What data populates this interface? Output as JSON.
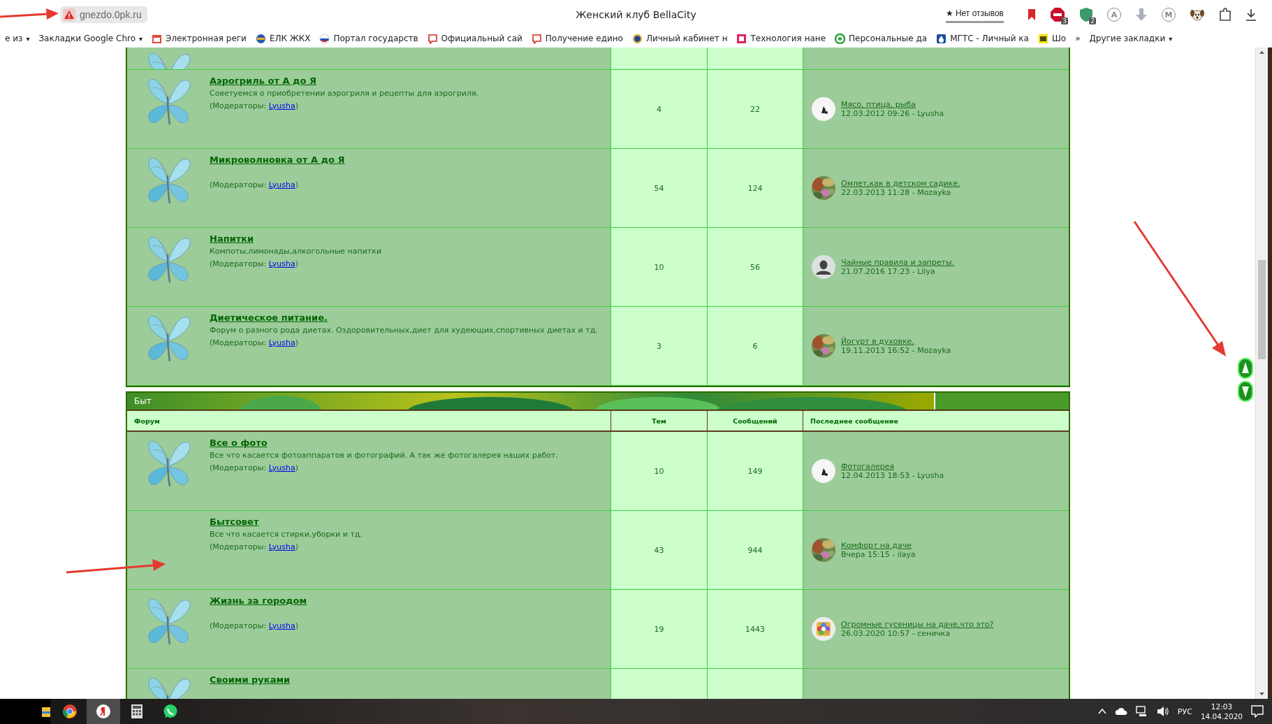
{
  "browser": {
    "url": "gnezdo.0pk.ru",
    "title": "Женский клуб BellaCity",
    "reviews": "★ Нет отзывов",
    "extensions": [
      {
        "kind": "bookmark"
      },
      {
        "kind": "adblock",
        "badge": "3"
      },
      {
        "kind": "shield",
        "badge": "2"
      },
      {
        "kind": "letter",
        "glyph": "A"
      },
      {
        "kind": "arrow-down"
      },
      {
        "kind": "letter",
        "glyph": "M"
      },
      {
        "kind": "dog"
      },
      {
        "kind": "puzzle"
      },
      {
        "kind": "download"
      }
    ]
  },
  "bookmarks": [
    {
      "label": "е из",
      "caret": "▾"
    },
    {
      "label": "Закладки Google Chro",
      "caret": "▾"
    },
    {
      "label": "Электронная реги"
    },
    {
      "label": "ЕЛК ЖКХ"
    },
    {
      "label": "Портал государств"
    },
    {
      "label": "Официальный сай"
    },
    {
      "label": "Получение едино"
    },
    {
      "label": "Личный кабинет н"
    },
    {
      "label": "Технология нане"
    },
    {
      "label": "Персональные да"
    },
    {
      "label": "МГТС - Личный ка"
    },
    {
      "label": "Шо"
    },
    {
      "label": "»"
    },
    {
      "label": "Другие закладки",
      "caret": "▾"
    }
  ],
  "sections": [
    {
      "kind": "continued",
      "forums": [
        {
          "kind": "cut-top",
          "has_icon": true
        },
        {
          "kind": "full",
          "has_icon": true,
          "title": "Аэрогриль от А до Я",
          "description": "Советуемся о приобретении аэрогриля и рецепты для аэрогриля.",
          "moderators_label": "(Модераторы: ",
          "moderator": "Lyusha",
          "moderators_end": ")",
          "topics": "4",
          "posts": "22",
          "last_post": {
            "kind": "figure",
            "title": "Мясо, птица, рыба",
            "meta": "12.03.2012 09:26 - Lyusha"
          }
        },
        {
          "kind": "full",
          "has_icon": true,
          "title": "Микроволновка от А до Я",
          "moderators_label": "(Модераторы: ",
          "moderator": "Lyusha",
          "moderators_end": ")",
          "topics": "54",
          "posts": "124",
          "last_post": {
            "title": "Омлет,как в детском садике.",
            "meta": "22.03.2013 11:28 - Mozayka"
          }
        },
        {
          "kind": "full",
          "has_icon": true,
          "title": "Напитки",
          "description": "Компоты,лимонады,алкогольные напитки",
          "moderators_label": "(Модераторы: ",
          "moderator": "Lyusha",
          "moderators_end": ")",
          "topics": "10",
          "posts": "56",
          "last_post": {
            "kind": "silhouette",
            "title": "Чайные правила и запреты.",
            "meta": "21.07.2016 17:23 - Lilya"
          }
        },
        {
          "kind": "full",
          "has_icon": true,
          "title": "Диетическое питание.",
          "description": "Форум о разного рода диетах. Оздоровительных,диет для худеющих,спортивных диетах и тд.",
          "moderators_label": "(Модераторы: ",
          "moderator": "Lyusha",
          "moderators_end": ")",
          "topics": "3",
          "posts": "6",
          "last_post": {
            "title": "Йогурт в духовке.",
            "meta": "19.11.2013 16:52 - Mozayka"
          }
        }
      ]
    },
    {
      "kind": "category",
      "title": "Быт",
      "columns": [
        "Форум",
        "Тем",
        "Сообщений",
        "Последнее сообщение"
      ],
      "forums": [
        {
          "kind": "full",
          "has_icon": true,
          "title": "Все о фото",
          "description": "Все что касается фотоаппаратов и фотографий. А так же фотогалерея наших работ.",
          "moderators_label": "(Модераторы: ",
          "moderator": "Lyusha",
          "moderators_end": ")",
          "topics": "10",
          "posts": "149",
          "last_post": {
            "kind": "figure",
            "title": "Фотогалерея",
            "meta": "12.04.2013 18:53 - Lyusha"
          }
        },
        {
          "kind": "full",
          "has_icon": false,
          "title": "Бытсовет",
          "description": "Все что касается стирки,уборки и тд.",
          "moderators_label": "(Модераторы: ",
          "moderator": "Lyusha",
          "moderators_end": ")",
          "topics": "43",
          "posts": "944",
          "last_post": {
            "title": "Комфорт на даче",
            "meta": "Вчера 15:15 - ilaya"
          }
        },
        {
          "kind": "full",
          "has_icon": true,
          "title": "Жизнь за городом",
          "moderators_label": "(Модераторы: ",
          "moderator": "Lyusha",
          "moderators_end": ")",
          "topics": "19",
          "posts": "1443",
          "last_post": {
            "kind": "flower",
            "title": "Огромные гусеницы на даче,что это?",
            "meta": "26.03.2020 10:57 - сеничка"
          }
        },
        {
          "kind": "cut-bottom",
          "has_icon": true,
          "title": "Своими руками"
        }
      ]
    }
  ],
  "taskbar": {
    "apps": [
      {
        "kind": "folder",
        "selected": false
      },
      {
        "kind": "chrome",
        "selected": false
      },
      {
        "kind": "yandex",
        "selected": true
      },
      {
        "kind": "calculator",
        "selected": false
      },
      {
        "kind": "whatsapp",
        "selected": false
      }
    ],
    "language": "РУС",
    "time": "12:03",
    "date": "14.04.2020"
  }
}
